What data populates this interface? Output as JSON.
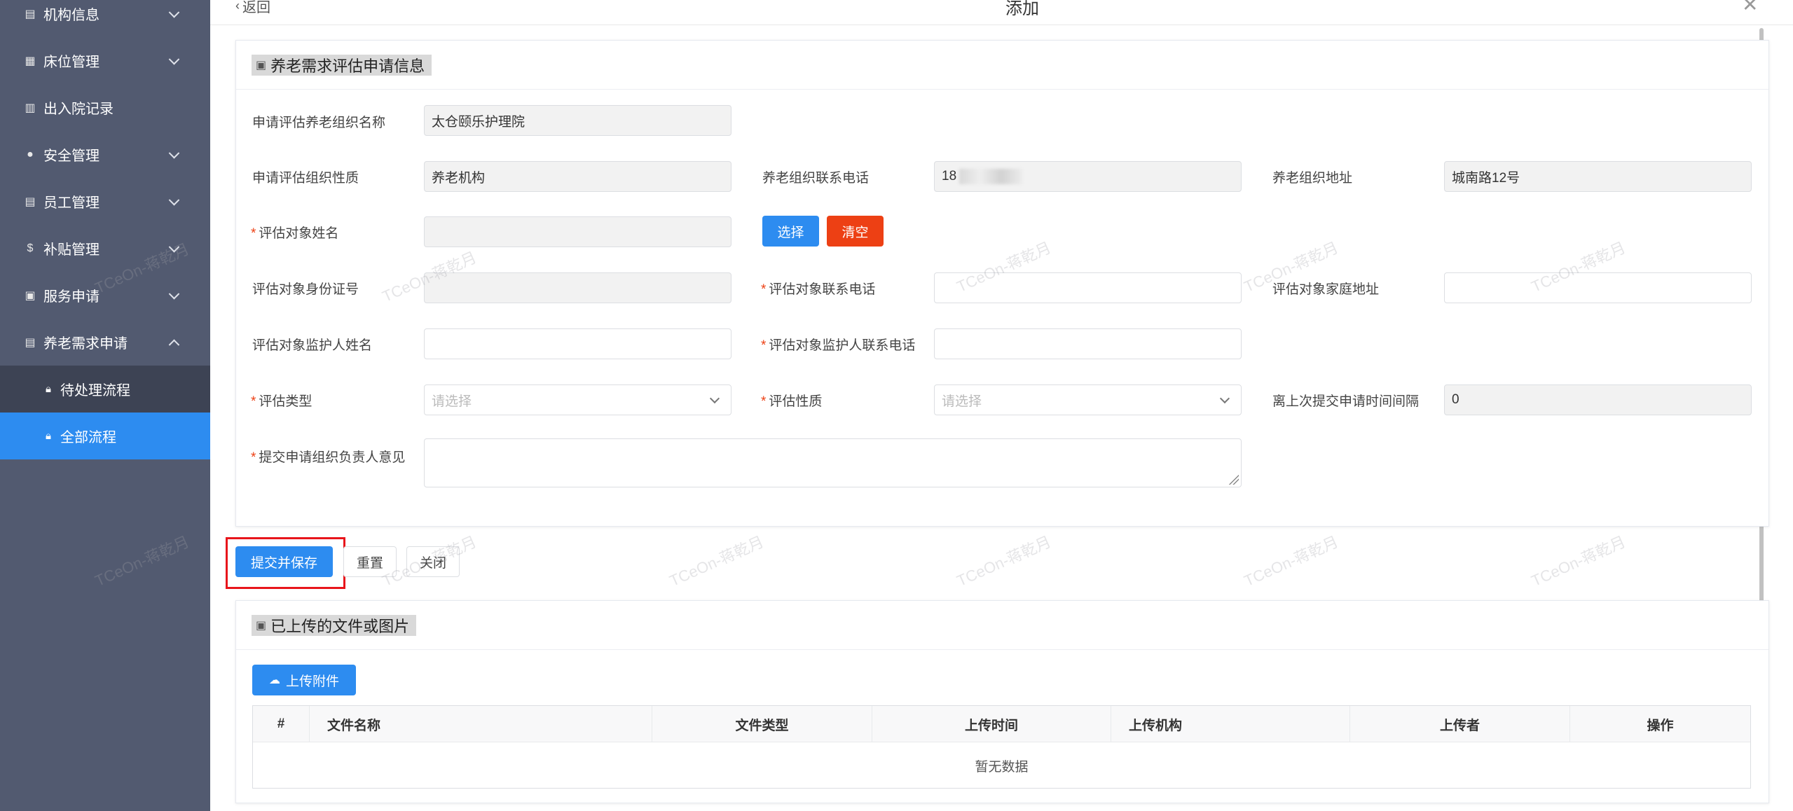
{
  "sidebar": {
    "items": [
      {
        "label": "机构信息",
        "icon": "book-icon",
        "has_children": true
      },
      {
        "label": "床位管理",
        "icon": "grid-icon",
        "has_children": true
      },
      {
        "label": "出入院记录",
        "icon": "record-icon",
        "has_children": false
      },
      {
        "label": "安全管理",
        "icon": "shield-dot-icon",
        "has_children": true
      },
      {
        "label": "员工管理",
        "icon": "book-icon",
        "has_children": true
      },
      {
        "label": "补贴管理",
        "icon": "dollar-icon",
        "has_children": true
      },
      {
        "label": "服务申请",
        "icon": "calendar-icon",
        "has_children": true
      },
      {
        "label": "养老需求申请",
        "icon": "document-icon",
        "has_children": true,
        "expanded": true
      }
    ],
    "sub_items": [
      {
        "label": "待处理流程",
        "icon": "lock-icon",
        "selected": false
      },
      {
        "label": "全部流程",
        "icon": "lock-icon",
        "selected": true
      }
    ],
    "colors": {
      "background": "#525a70",
      "sub_background": "#3d4354",
      "selected": "#2d8cf0"
    }
  },
  "header": {
    "back_label": "返回",
    "title": "添加"
  },
  "form_section": {
    "title": "养老需求评估申请信息",
    "fields": {
      "org_name": {
        "label": "申请评估养老组织名称",
        "value": "太仓颐乐护理院"
      },
      "org_type": {
        "label": "申请评估组织性质",
        "value": "养老机构"
      },
      "org_phone": {
        "label": "养老组织联系电话",
        "value": "18"
      },
      "org_address": {
        "label": "养老组织地址",
        "value": "城南路12号"
      },
      "subject_name": {
        "label": "评估对象姓名",
        "value": ""
      },
      "subject_id": {
        "label": "评估对象身份证号",
        "value": ""
      },
      "subject_phone": {
        "label": "评估对象联系电话",
        "value": ""
      },
      "subject_address": {
        "label": "评估对象家庭地址",
        "value": ""
      },
      "guardian_name": {
        "label": "评估对象监护人姓名",
        "value": ""
      },
      "guardian_phone": {
        "label": "评估对象监护人联系电话",
        "value": ""
      },
      "eval_type": {
        "label": "评估类型",
        "placeholder": "请选择"
      },
      "eval_nature": {
        "label": "评估性质",
        "placeholder": "请选择"
      },
      "interval": {
        "label": "离上次提交申请时间间隔",
        "value": "0"
      },
      "opinion": {
        "label": "提交申请组织负责人意见",
        "value": ""
      }
    },
    "select_button": "选择",
    "clear_button": "清空"
  },
  "actions": {
    "submit": "提交并保存",
    "reset": "重置",
    "close": "关闭"
  },
  "upload_section": {
    "title": "已上传的文件或图片",
    "upload_button": "上传附件",
    "columns": [
      "#",
      "文件名称",
      "文件类型",
      "上传时间",
      "上传机构",
      "上传者",
      "操作"
    ],
    "empty_text": "暂无数据"
  },
  "watermark": "TCeOn-蒋乾月"
}
